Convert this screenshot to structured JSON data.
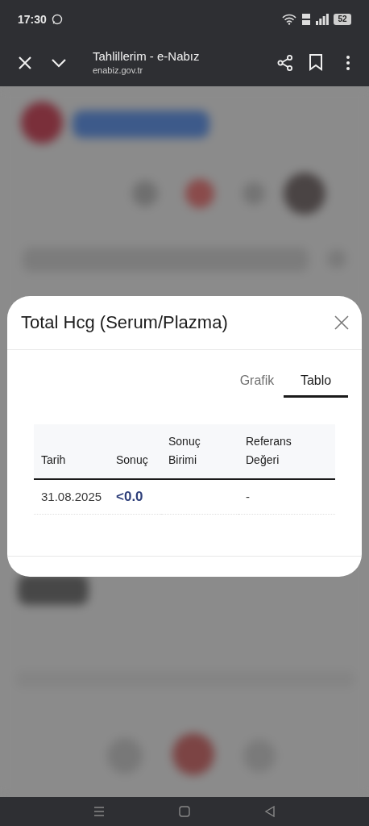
{
  "status_bar": {
    "time": "17:30",
    "battery": "52"
  },
  "toolbar": {
    "title": "Tahlillerim - e-Nabız",
    "url": "enabiz.gov.tr"
  },
  "modal": {
    "title": "Total Hcg (Serum/Plazma)",
    "tabs": [
      {
        "label": "Grafik",
        "selected": false
      },
      {
        "label": "Tablo",
        "selected": true
      }
    ],
    "table": {
      "columns": [
        "Tarih",
        "Sonuç",
        "Sonuç Birimi",
        "Referans Değeri"
      ],
      "rows": [
        {
          "cells": [
            "31.08.2025",
            "<0.0",
            null,
            "-"
          ]
        }
      ]
    }
  }
}
